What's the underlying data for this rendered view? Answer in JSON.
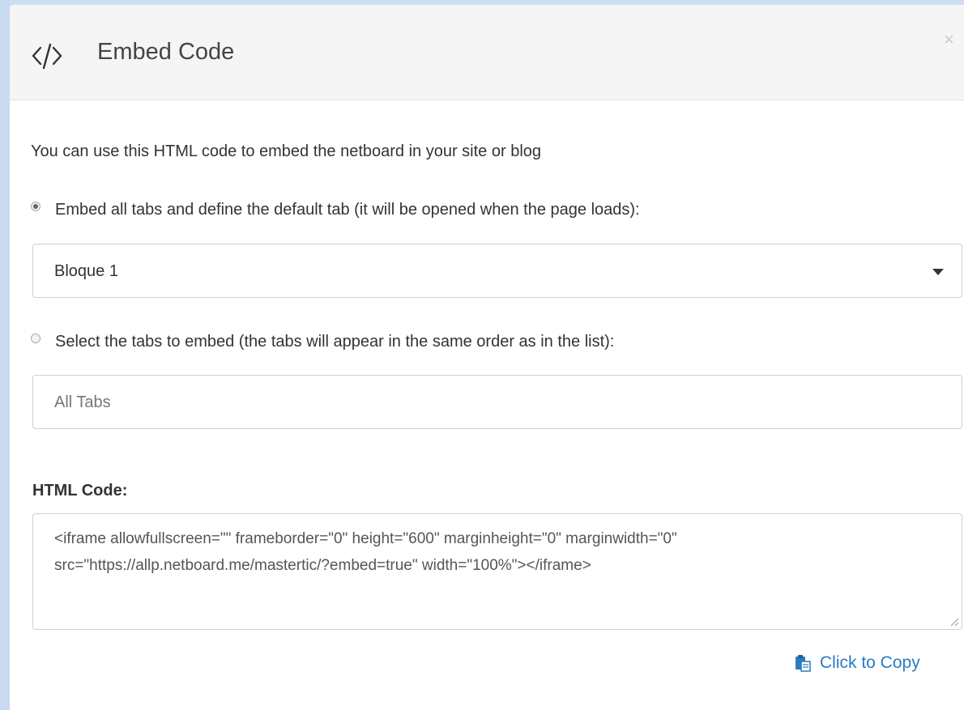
{
  "modal": {
    "title": "Embed Code",
    "close_label": "×",
    "intro": "You can use this HTML code to embed the netboard in your site or blog",
    "option_all_tabs": {
      "label": "Embed all tabs and define the default tab (it will be opened when the page loads):",
      "checked": true
    },
    "default_tab_select": {
      "value": "Bloque 1"
    },
    "option_select_tabs": {
      "label": "Select the tabs to embed (the tabs will appear in the same order as in the list):",
      "checked": false
    },
    "tabs_input": {
      "placeholder": "All Tabs"
    },
    "html_code_label": "HTML Code:",
    "html_code_value": "<iframe allowfullscreen=\"\" frameborder=\"0\" height=\"600\" marginheight=\"0\" marginwidth=\"0\" src=\"https://allp.netboard.me/mastertic/?embed=true\" width=\"100%\"></iframe>",
    "copy_label": "Click to Copy"
  },
  "colors": {
    "link": "#2a7bc0",
    "header_bg": "#f5f5f5",
    "backdrop": "#cfdff2"
  },
  "icons": {
    "header_icon": "code-icon",
    "close_icon": "close-icon",
    "copy_icon": "clipboard-icon",
    "select_icon": "caret-down-icon"
  }
}
